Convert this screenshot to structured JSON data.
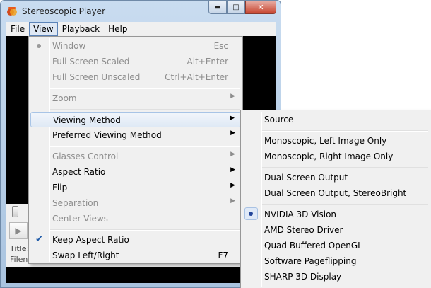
{
  "window": {
    "title": "Stereoscopic Player"
  },
  "menubar": [
    {
      "label": "File",
      "active": false
    },
    {
      "label": "View",
      "active": true
    },
    {
      "label": "Playback",
      "active": false
    },
    {
      "label": "Help",
      "active": false
    }
  ],
  "info": {
    "title_label": "Title:",
    "filename_label": "Filena"
  },
  "view_menu": {
    "items": [
      {
        "label": "Window",
        "shortcut": "Esc",
        "disabled": true,
        "radio": true
      },
      {
        "label": "Full Screen Scaled",
        "shortcut": "Alt+Enter",
        "disabled": true
      },
      {
        "label": "Full Screen Unscaled",
        "shortcut": "Ctrl+Alt+Enter",
        "disabled": true
      },
      {
        "label": "Zoom",
        "submenu": true,
        "disabled": true
      },
      {
        "label": "Viewing Method",
        "submenu": true,
        "highlighted": true
      },
      {
        "label": "Preferred Viewing Method",
        "submenu": true
      },
      {
        "label": "Glasses Control",
        "submenu": true,
        "disabled": true
      },
      {
        "label": "Aspect Ratio",
        "submenu": true
      },
      {
        "label": "Flip",
        "submenu": true
      },
      {
        "label": "Separation",
        "submenu": true,
        "disabled": true
      },
      {
        "label": "Center Views",
        "disabled": true
      },
      {
        "label": "Keep Aspect Ratio",
        "checked": true
      },
      {
        "label": "Swap Left/Right",
        "shortcut": "F7"
      }
    ]
  },
  "viewing_method_menu": {
    "items": [
      {
        "label": "Source"
      },
      {
        "label": "Monoscopic, Left Image Only"
      },
      {
        "label": "Monoscopic, Right Image Only"
      },
      {
        "label": "Dual Screen Output"
      },
      {
        "label": "Dual Screen Output, StereoBright"
      },
      {
        "label": "NVIDIA 3D Vision",
        "selected": true
      },
      {
        "label": "AMD Stereo Driver"
      },
      {
        "label": "Quad Buffered OpenGL"
      },
      {
        "label": "Software Pageflipping"
      },
      {
        "label": "SHARP 3D Display"
      }
    ]
  }
}
